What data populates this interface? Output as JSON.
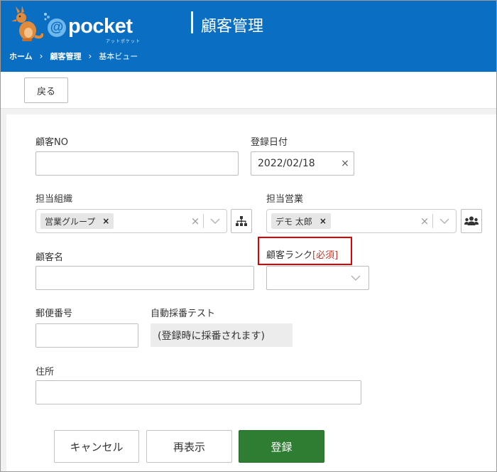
{
  "header": {
    "logo_at": "@",
    "logo_word": "pocket",
    "logo_sub": "アットポケット",
    "title": "顧客管理",
    "breadcrumb": {
      "home": "ホーム",
      "section": "顧客管理",
      "current": "基本ビュー",
      "separator": "›"
    }
  },
  "toolbar": {
    "back_label": "戻る"
  },
  "form": {
    "customer_no": {
      "label": "顧客NO",
      "value": ""
    },
    "registration_date": {
      "label": "登録日付",
      "value": "2022/02/18",
      "clear": "×"
    },
    "org": {
      "label": "担当組織",
      "chip": "営業グループ",
      "chip_remove": "×",
      "clear": "×",
      "icon": "org-chart-icon"
    },
    "sales_rep": {
      "label": "担当営業",
      "chip": "デモ 太郎",
      "chip_remove": "×",
      "clear": "×",
      "icon": "users-group-icon"
    },
    "customer_name": {
      "label": "顧客名",
      "value": ""
    },
    "customer_rank": {
      "label": "顧客ランク",
      "required": "[必須]",
      "value": ""
    },
    "postal_code": {
      "label": "郵便番号",
      "value": ""
    },
    "auto_number": {
      "label": "自動採番テスト",
      "value": "(登録時に採番されます)"
    },
    "address": {
      "label": "住所",
      "value": ""
    }
  },
  "actions": {
    "cancel": "キャンセル",
    "refresh": "再表示",
    "register": "登録"
  },
  "colors": {
    "header": "#0a6fc2",
    "primary": "#2f7d32",
    "required": "#c0392b",
    "highlight": "#e00000"
  }
}
